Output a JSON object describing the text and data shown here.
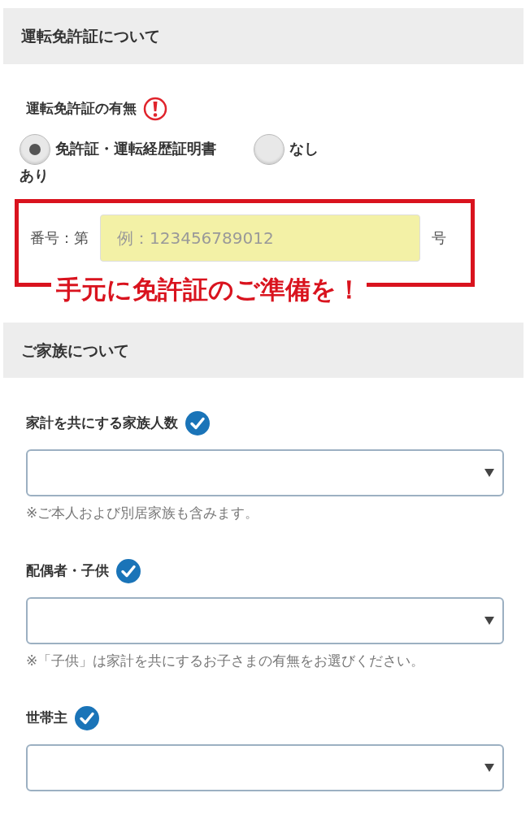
{
  "sections": [
    {
      "title": "運転免許証について",
      "fields": [
        {
          "kind": "radio",
          "label": "運転免許証の有無",
          "required": true,
          "options": [
            {
              "label": "免許証・運転経歴証明書あり",
              "selected": true
            },
            {
              "label": "なし",
              "selected": false
            }
          ]
        },
        {
          "kind": "number",
          "prefix": "番号：第",
          "placeholder": "例：123456789012",
          "suffix": "号",
          "highlighted": true,
          "callout": "手元に免許証のご準備を！"
        }
      ]
    },
    {
      "title": "ご家族について",
      "fields": [
        {
          "kind": "select",
          "label": "家計を共にする家族人数",
          "required": false,
          "note": "※ご本人および別居家族も含みます。"
        },
        {
          "kind": "select",
          "label": "配偶者・子供",
          "required": false,
          "note": "※「子供」は家計を共にするお子さまの有無をお選びください。"
        },
        {
          "kind": "select",
          "label": "世帯主",
          "required": false
        }
      ]
    }
  ]
}
